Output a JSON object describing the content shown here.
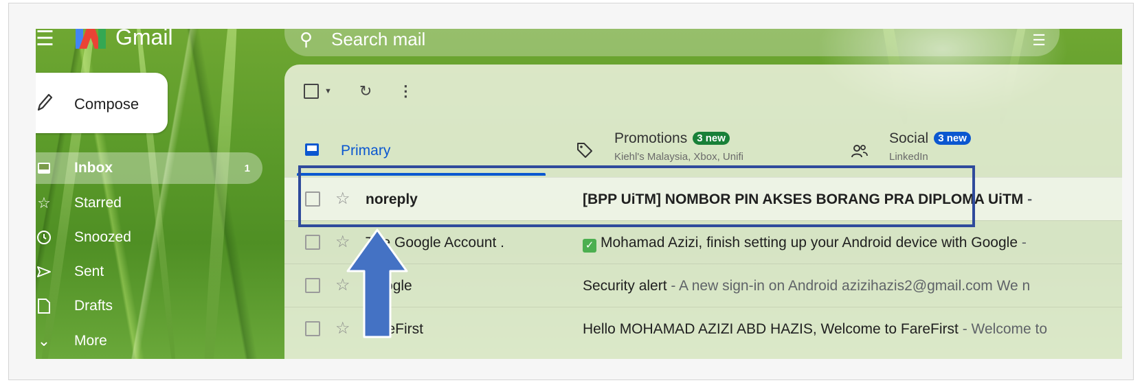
{
  "colors": {
    "accent": "#0b57d0",
    "promotions_badge": "#188038",
    "social_badge": "#0b57d0",
    "annotation": "#2f4a9c",
    "arrow": "#4472c4"
  },
  "header": {
    "app_name": "Gmail",
    "search_placeholder": "Search mail",
    "menu_icon": "hamburger-icon",
    "search_icon": "search-icon",
    "filter_icon": "tune-icon"
  },
  "compose": {
    "label": "Compose",
    "icon": "pencil-icon"
  },
  "nav": {
    "items": [
      {
        "label": "Inbox",
        "icon": "inbox-icon",
        "count": "1",
        "active": true
      },
      {
        "label": "Starred",
        "icon": "star-icon"
      },
      {
        "label": "Snoozed",
        "icon": "clock-icon"
      },
      {
        "label": "Sent",
        "icon": "send-icon"
      },
      {
        "label": "Drafts",
        "icon": "draft-icon"
      },
      {
        "label": "More",
        "icon": "chevron-down-icon"
      }
    ]
  },
  "toolbar": {
    "select_icon": "checkbox-icon",
    "refresh_icon": "refresh-icon",
    "more_icon": "more-vert-icon"
  },
  "tabs": {
    "primary": {
      "label": "Primary",
      "icon": "inbox-icon"
    },
    "promotions": {
      "label": "Promotions",
      "badge": "3 new",
      "sub": "Kiehl's Malaysia, Xbox, Unifi",
      "icon": "tag-icon"
    },
    "social": {
      "label": "Social",
      "badge": "3 new",
      "sub": "LinkedIn",
      "icon": "people-icon"
    }
  },
  "emails": [
    {
      "sender": "noreply",
      "subject": "[BPP UiTM] NOMBOR PIN AKSES BORANG PRA DIPLOMA UiTM",
      "snippet": " -",
      "unread": true
    },
    {
      "sender": "The Google Account .",
      "subject": "Mohamad Azizi, finish setting up your Android device with Google",
      "snippet": " -",
      "unread": false,
      "emoji": "check-mark-icon"
    },
    {
      "sender": "Google",
      "subject": "Security alert",
      "snippet": " - A new sign-in on Android azizihazis2@gmail.com We n",
      "unread": false
    },
    {
      "sender": "FareFirst",
      "subject": "Hello MOHAMAD AZIZI ABD HAZIS, Welcome to FareFirst",
      "snippet": " - Welcome to",
      "unread": false
    }
  ]
}
